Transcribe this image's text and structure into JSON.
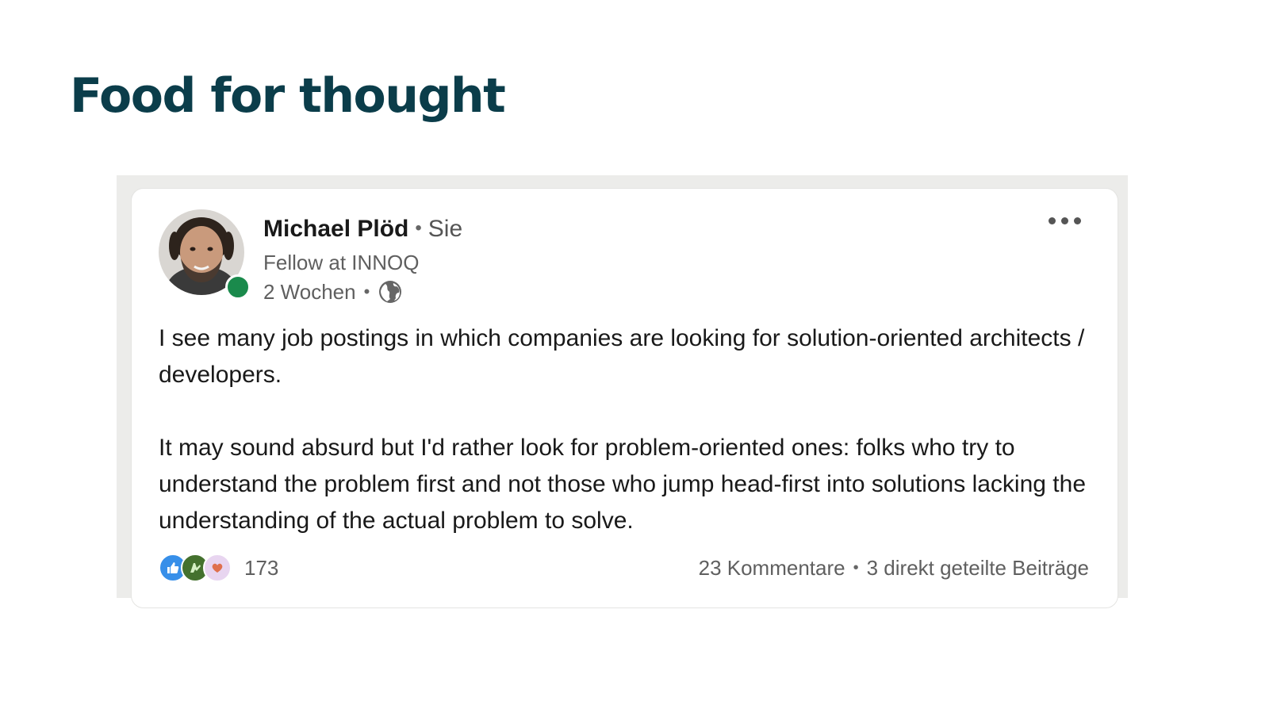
{
  "slide": {
    "title": "Food for thought"
  },
  "post": {
    "author": {
      "name": "Michael Plöd",
      "connection": "Sie",
      "headline": "Fellow at INNOQ",
      "online": true
    },
    "meta": {
      "time": "2 Wochen",
      "visibility_icon": "globe-icon"
    },
    "more_icon": "ellipsis-icon",
    "text": {
      "paragraph_1": "I see many job postings in which companies are looking for solution-oriented architects / developers.",
      "paragraph_2": "It may sound absurd but I'd rather look for problem-oriented ones: folks who try to understand the problem first and not those who jump head-first into solutions lacking the understanding of the actual problem to solve."
    },
    "social": {
      "reaction_icons": [
        "like-icon",
        "celebrate-icon",
        "love-icon"
      ],
      "reaction_count": "173",
      "comments": "23 Kommentare",
      "reposts": "3 direkt geteilte Beiträge",
      "separator": "•"
    }
  },
  "colors": {
    "title": "#0b3d4a",
    "online": "#1a8a4c",
    "like": "#378fe9",
    "celebrate": "#44712e",
    "love": "#df704d"
  }
}
